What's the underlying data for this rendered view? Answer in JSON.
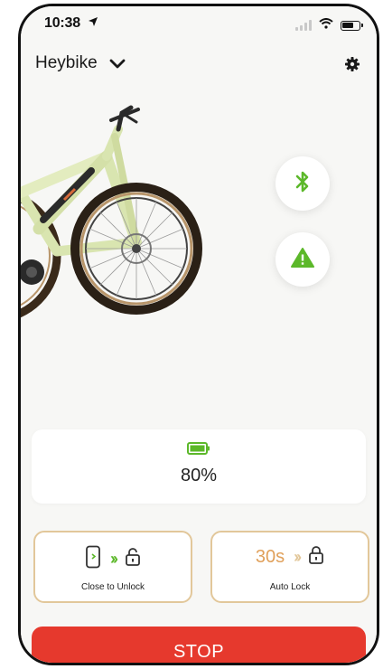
{
  "status_bar": {
    "time": "10:38"
  },
  "header": {
    "device_name": "Heybike"
  },
  "battery": {
    "percent_label": "80%",
    "level": 0.8
  },
  "close_to_unlock": {
    "label": "Close to Unlock"
  },
  "auto_lock": {
    "label": "Auto Lock",
    "timer": "30s"
  },
  "stop_button": {
    "label": "STOP"
  },
  "colors": {
    "accent_red": "#e6392d",
    "accent_green": "#5cb82a",
    "card_border": "#e2c79a",
    "timer_orange": "#e0a05a"
  }
}
